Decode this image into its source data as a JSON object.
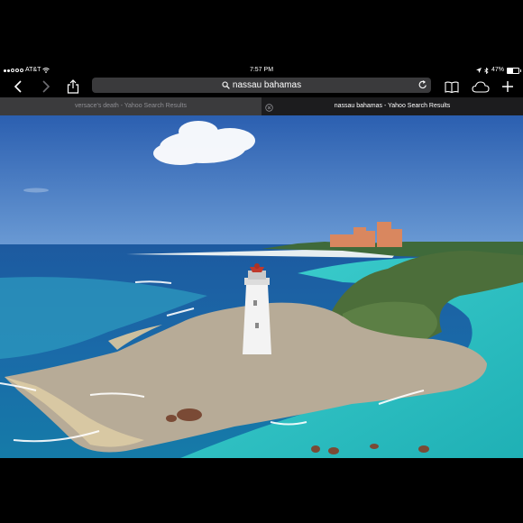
{
  "status": {
    "carrier": "AT&T",
    "time": "7:57 PM",
    "battery": "47%",
    "battery_level": 0.47
  },
  "toolbar": {
    "address": "nassau bahamas",
    "icons": [
      "back-icon",
      "forward-icon",
      "share-icon",
      "search-icon",
      "reload-icon",
      "bookmarks-icon",
      "icloud-tabs-icon",
      "new-tab-icon"
    ]
  },
  "tabs": [
    {
      "label": "versace's death - Yahoo Search Results",
      "active": false
    },
    {
      "label": "nassau bahamas - Yahoo Search Results",
      "active": true
    }
  ],
  "colors": {
    "sky_top": "#2b5fb0",
    "sky_bottom": "#6a9ad4",
    "deep_water": "#1e4f8e",
    "turquoise": "#2fc4c2",
    "rock": "#b7ab97",
    "vegetation": "#4c6e3a",
    "hotel": "#d9875f"
  }
}
